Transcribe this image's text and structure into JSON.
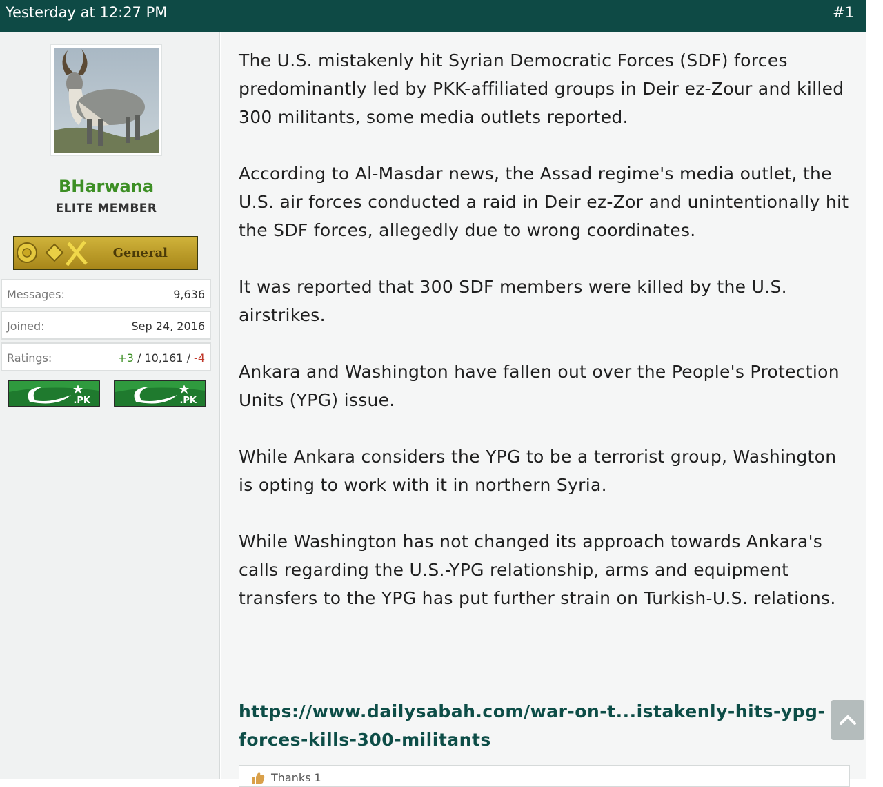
{
  "header": {
    "timestamp": "Yesterday at 12:27 PM",
    "post_number": "#1"
  },
  "user": {
    "name": "BHarwana",
    "title": "ELITE MEMBER",
    "rank": "General",
    "stats": {
      "messages_label": "Messages:",
      "messages_value": "9,636",
      "joined_label": "Joined:",
      "joined_value": "Sep 24, 2016",
      "ratings_label": "Ratings:",
      "ratings_pos": "+3",
      "ratings_sep1": " / ",
      "ratings_mid": "10,161",
      "ratings_sep2": " / ",
      "ratings_neg": "-4"
    },
    "flags": [
      ".PK",
      ".PK"
    ]
  },
  "post": {
    "paragraphs": [
      "The U.S. mistakenly hit Syrian Democratic Forces (SDF) forces predominantly led by PKK-affiliated groups in Deir ez-Zour and killed 300 militants, some media outlets reported.",
      "According to Al-Masdar news, the Assad regime's media outlet, the U.S. air forces conducted a raid in Deir ez-Zor and unintentionally hit the SDF forces, allegedly due to wrong coordinates.",
      "It was reported that 300 SDF members were killed by the U.S. airstrikes.",
      "Ankara and Washington have fallen out over the People's Protection Units (YPG) issue.",
      "While Ankara considers the YPG to be a terrorist group, Washington is opting to work with it in northern Syria.",
      "While Washington has not changed its approach towards Ankara's calls regarding the U.S.-YPG relationship, arms and equipment transfers to the YPG has put further strain on Turkish-U.S. relations."
    ],
    "link": "https://www.dailysabah.com/war-on-t...istakenly-hits-ypg-forces-kills-300-militants"
  },
  "reactions": {
    "text": "Thanks 1"
  },
  "colors": {
    "header_bg": "#0e4a45",
    "username": "#3d8f25",
    "link": "#0d4d47",
    "negative": "#c0392b"
  },
  "icons": {
    "scroll_top": "chevron-up-icon",
    "thumb": "thumb-up-icon"
  }
}
